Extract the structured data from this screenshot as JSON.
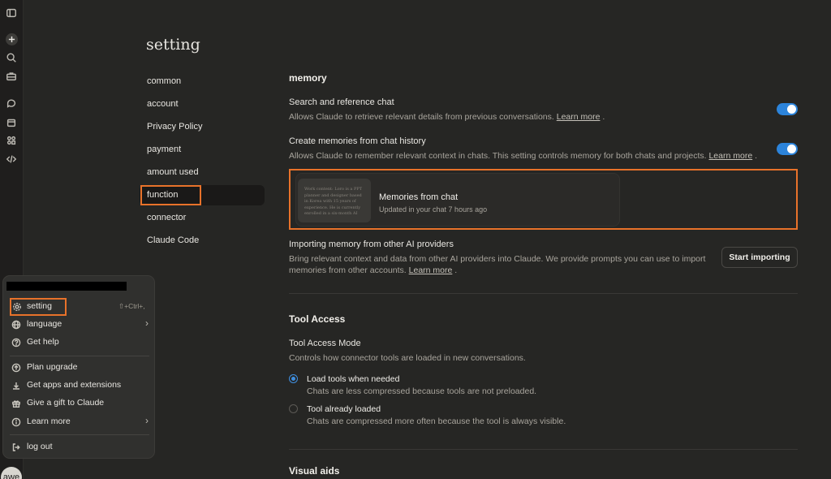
{
  "page": {
    "title": "setting"
  },
  "nav": {
    "items": [
      "common",
      "account",
      "Privacy Policy",
      "payment",
      "amount used",
      "function",
      "connector",
      "Claude Code"
    ],
    "active": "function"
  },
  "memory": {
    "section_title": "memory",
    "search_ref": {
      "title": "Search and reference chat",
      "desc": "Allows Claude to retrieve relevant details from previous conversations.",
      "link": "Learn more",
      "enabled": true
    },
    "create_mem": {
      "title": "Create memories from chat history",
      "desc": "Allows Claude to remember relevant context in chats. This setting controls memory for both chats and projects.",
      "link": "Learn more",
      "enabled": true
    },
    "card": {
      "thumb_text": "Work content: Loro is a PPT planner and designer based in Korea with 15 years of experience. He is currently enrolled in a six-month AI",
      "title": "Memories from chat",
      "subtitle": "Updated in your chat 7 hours ago"
    },
    "import": {
      "title": "Importing memory from other AI providers",
      "desc_line1": "Bring relevant context and data from other AI providers into Claude. We provide prompts you can use to import",
      "desc_line2": "memories from other accounts.",
      "link": "Learn more",
      "button": "Start importing"
    }
  },
  "tool_access": {
    "section_title": "Tool Access",
    "mode_title": "Tool Access Mode",
    "mode_desc": "Controls how connector tools are loaded in new conversations.",
    "options": [
      {
        "label": "Load tools when needed",
        "desc": "Chats are less compressed because tools are not preloaded.",
        "selected": true
      },
      {
        "label": "Tool already loaded",
        "desc": "Chats are compressed more often because the tool is always visible.",
        "selected": false
      }
    ]
  },
  "visual_aids": {
    "section_title": "Visual aids"
  },
  "menu": {
    "items": [
      {
        "label": "setting",
        "icon": "gear-icon",
        "shortcut": "⇧+Ctrl+,"
      },
      {
        "label": "language",
        "icon": "globe-icon",
        "chevron": "›"
      },
      {
        "label": "Get help",
        "icon": "help-icon"
      },
      {
        "label": "Plan upgrade",
        "icon": "upgrade-icon"
      },
      {
        "label": "Get apps and extensions",
        "icon": "download-icon"
      },
      {
        "label": "Give a gift to Claude",
        "icon": "gift-icon"
      },
      {
        "label": "Learn more",
        "icon": "info-icon",
        "chevron": "›"
      },
      {
        "label": "log out",
        "icon": "logout-icon"
      }
    ]
  },
  "user": {
    "avatar_text": "awe"
  },
  "colors": {
    "accent": "#2c84db",
    "highlight": "#e8722a",
    "background": "#262624"
  }
}
